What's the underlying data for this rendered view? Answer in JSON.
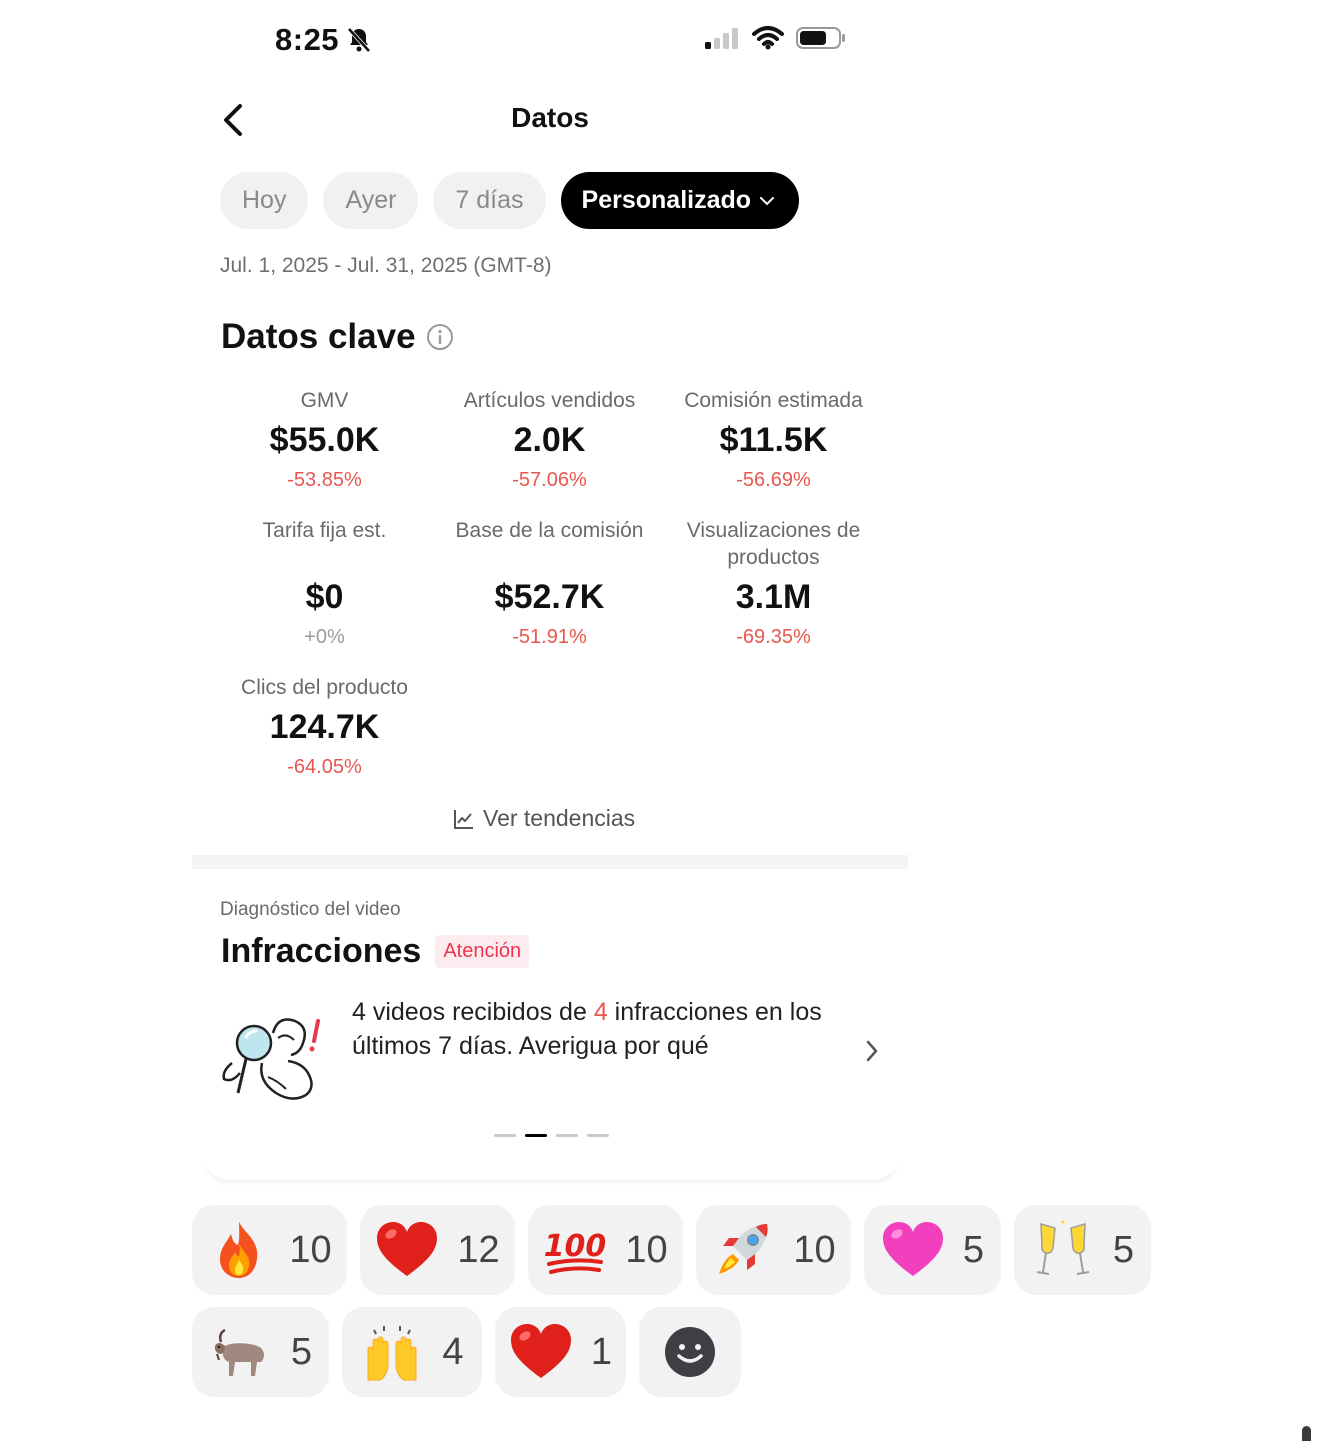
{
  "status_bar": {
    "time": "8:25"
  },
  "nav": {
    "title": "Datos"
  },
  "tabs": [
    {
      "label": "Hoy"
    },
    {
      "label": "Ayer"
    },
    {
      "label": "7 días"
    },
    {
      "label": "Personalizado"
    }
  ],
  "date_range": "Jul. 1, 2025 - Jul. 31, 2025 (GMT-8)",
  "key_data": {
    "title": "Datos clave",
    "metrics": [
      {
        "label": "GMV",
        "value": "$55.0K",
        "change": "-53.85%"
      },
      {
        "label": "Artículos vendidos",
        "value": "2.0K",
        "change": "-57.06%"
      },
      {
        "label": "Comisión estimada",
        "value": "$11.5K",
        "change": "-56.69%"
      },
      {
        "label": "Tarifa fija est.",
        "value": "$0",
        "change": "+0%"
      },
      {
        "label": "Base de la comisión",
        "value": "$52.7K",
        "change": "-51.91%"
      },
      {
        "label": "Visualizaciones de productos",
        "value": "3.1M",
        "change": "-69.35%"
      },
      {
        "label": "Clics del producto",
        "value": "124.7K",
        "change": "-64.05%"
      }
    ],
    "trends_label": "Ver tendencias"
  },
  "diagnosis": {
    "subtitle": "Diagnóstico del video",
    "title": "Infracciones",
    "badge": "Atención",
    "videos_count": "4",
    "text_1": " videos recibidos de ",
    "infractions_count": "4",
    "text_2": " infracciones en los últimos 7 días. Averigua por qué"
  },
  "reactions": [
    {
      "emoji": "fire",
      "count": "10"
    },
    {
      "emoji": "red-heart",
      "count": "12"
    },
    {
      "emoji": "hundred-points",
      "count": "10"
    },
    {
      "emoji": "rocket",
      "count": "10"
    },
    {
      "emoji": "pink-heart",
      "count": "5"
    },
    {
      "emoji": "clinking-glasses",
      "count": "5"
    },
    {
      "emoji": "goat",
      "count": "5"
    },
    {
      "emoji": "raising-hands",
      "count": "4"
    },
    {
      "emoji": "red-heart",
      "count": "1"
    }
  ],
  "colors": {
    "negative": "#e8574f",
    "active_tab": "#000000",
    "badge_bg": "#fdecef",
    "badge_text": "#e8374f"
  }
}
